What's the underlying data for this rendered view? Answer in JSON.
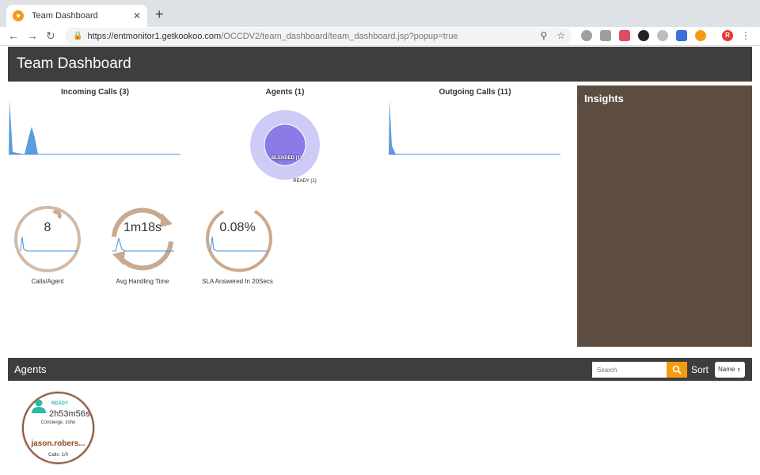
{
  "browser": {
    "tab_title": "Team Dashboard",
    "url_host": "https://entmonitor1.getkookoo.com",
    "url_path": "/OCCDV2/team_dashboard/team_dashboard.jsp?popup=true",
    "profile_initial": "R"
  },
  "header": {
    "title": "Team Dashboard"
  },
  "charts": {
    "incoming_title": "Incoming Calls (3)",
    "agents_title": "Agents (1)",
    "agents_inner_label": "BLENDED (1)",
    "agents_outer_label": "READY (1)",
    "outgoing_title": "Outgoing Calls (11)"
  },
  "insights": {
    "title": "Insights"
  },
  "kpis": [
    {
      "value": "8",
      "label": "Calls/Agent"
    },
    {
      "value": "1m18s",
      "label": "Avg Handling Time"
    },
    {
      "value": "0.08%",
      "label": "SLA Answered In 20Secs"
    }
  ],
  "agents_section": {
    "title": "Agents",
    "search_placeholder": "Search",
    "sort_label": "Sort",
    "sort_value": "Name"
  },
  "agent_card": {
    "status": "READY",
    "time": "2h53m56s",
    "queue": "Concierge, zoho",
    "name": "jason.robers...",
    "calls": "Calls: 1/0"
  },
  "colors": {
    "header_bg": "#3f3e3c",
    "insights_bg": "#5c4d40",
    "accent_orange": "#f39c12",
    "spark_blue": "#4a90d9",
    "ready_teal": "#2fb8a8",
    "donut_outer": "#cfcbf7",
    "donut_inner": "#8a7be6"
  }
}
